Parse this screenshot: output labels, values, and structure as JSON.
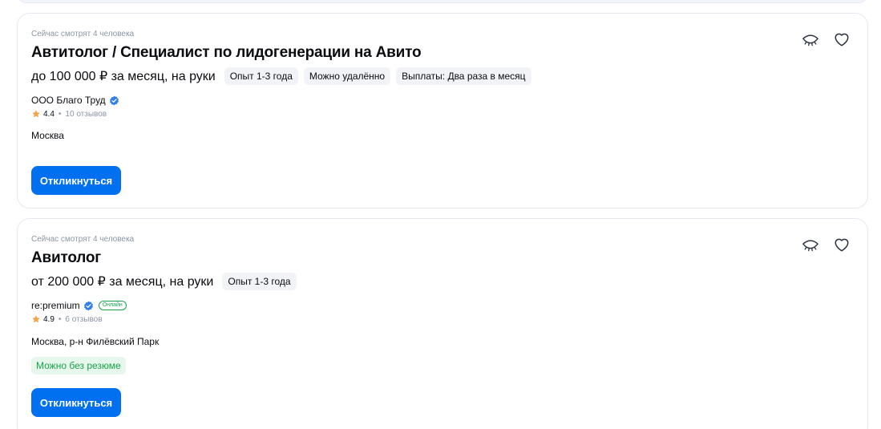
{
  "vacancies": [
    {
      "viewers": "Сейчас смотрят 4 человека",
      "title": "Автитолог / Специалист по лидогенерации на Авито",
      "salary": "до 100 000 ₽ за месяц, на руки",
      "tags": [
        "Опыт 1-3 года",
        "Можно удалённо",
        "Выплаты: Два раза в месяц"
      ],
      "company": "ООО Благо Труд",
      "rating": "4.4",
      "reviews": "10 отзывов",
      "location": "Москва",
      "apply_label": "Откликнуться"
    },
    {
      "viewers": "Сейчас смотрят 4 человека",
      "title": "Авитолог",
      "salary": "от 200 000 ₽ за месяц, на руки",
      "tags": [
        "Опыт 1-3 года"
      ],
      "company": "re:premium",
      "online_badge": "Онлайн",
      "rating": "4.9",
      "reviews": "6 отзывов",
      "location": "Москва, р-н Филёвский Парк",
      "no_resume": "Можно без резюме",
      "apply_label": "Откликнуться"
    }
  ],
  "colors": {
    "accent": "#0070f0",
    "success": "#1aa34a",
    "star": "#f5a44a",
    "verified": "#2f7ef5",
    "muted": "#8c96a6"
  }
}
